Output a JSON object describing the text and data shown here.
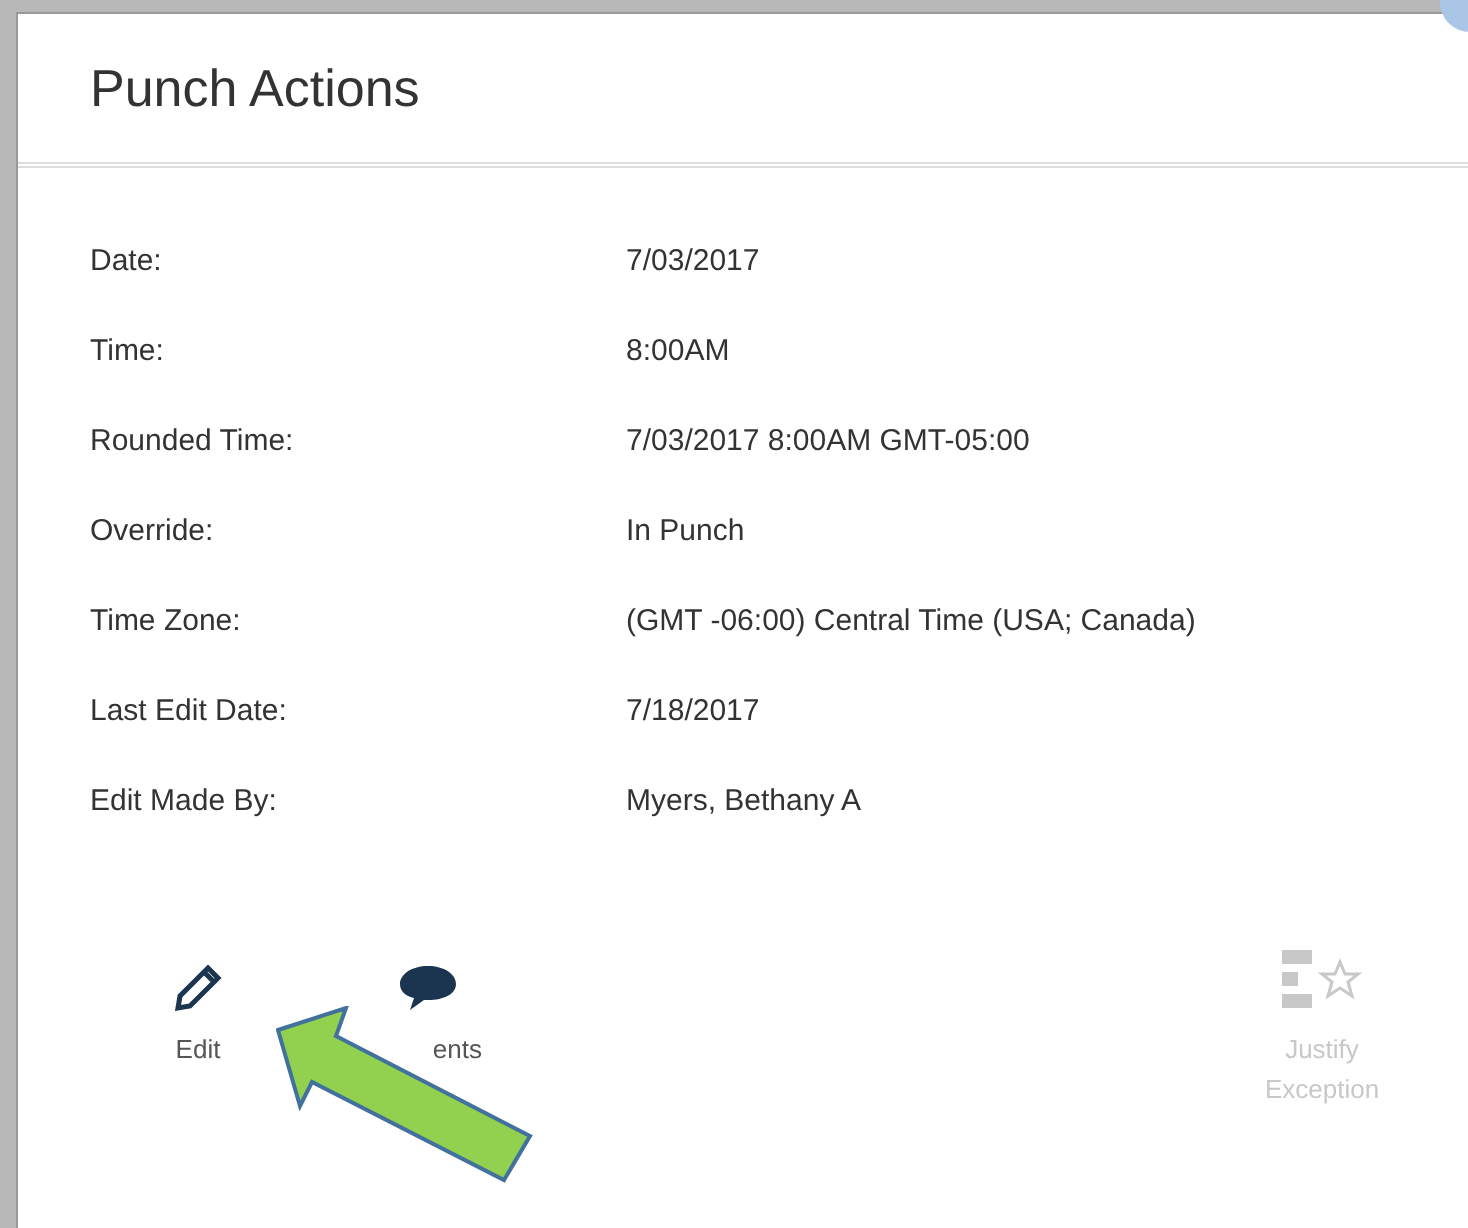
{
  "dialog": {
    "title": "Punch Actions"
  },
  "details": [
    {
      "label": "Date:",
      "value": "7/03/2017"
    },
    {
      "label": "Time:",
      "value": "8:00AM"
    },
    {
      "label": "Rounded Time:",
      "value": "7/03/2017 8:00AM GMT-05:00"
    },
    {
      "label": "Override:",
      "value": "In Punch"
    },
    {
      "label": "Time Zone:",
      "value": "(GMT -06:00) Central Time (USA; Canada)"
    },
    {
      "label": "Last Edit Date:",
      "value": "7/18/2017"
    },
    {
      "label": "Edit Made By:",
      "value": "Myers, Bethany A"
    }
  ],
  "actions": [
    {
      "kind": "edit",
      "label": "Edit",
      "disabled": false
    },
    {
      "kind": "comment",
      "label": "ents",
      "disabled": false
    },
    {
      "kind": "justify",
      "label": "Justify Exception",
      "disabled": true
    }
  ]
}
